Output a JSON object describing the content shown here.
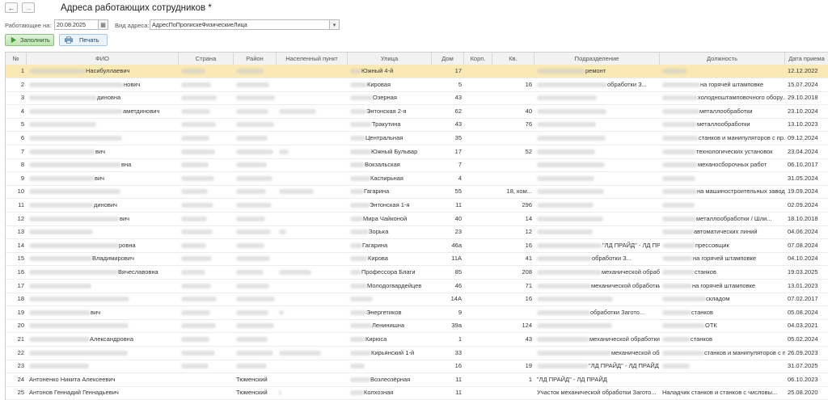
{
  "window": {
    "title": "Адреса работающих сотрудников *"
  },
  "nav": {
    "back_icon": "←",
    "forward_icon": "→"
  },
  "filters": {
    "working_on_label": "Работающие на:",
    "date_value": "20.08.2025",
    "calendar_icon": "▦",
    "address_type_label": "Вид адреса:",
    "address_type_value": "АдресПоПропискеФизическиеЛица",
    "dropdown_icon": "▾"
  },
  "toolbar": {
    "fill_label": "Заполнить",
    "print_label": "Печать"
  },
  "columns": [
    "№",
    "ФИО",
    "Страна",
    "Район",
    "Населенный пункт",
    "Улица",
    "Дом",
    "Корп.",
    "Кв.",
    "Подразделение",
    "Должность",
    "Дата приема"
  ],
  "rows": [
    {
      "n": "1",
      "fio": "Насибуллаевич",
      "street": "Южный 4-й",
      "house": "17",
      "corp": "",
      "flat": "",
      "dept": "ремонт",
      "pos": "",
      "date": "12.12.2022"
    },
    {
      "n": "2",
      "fio": "нович",
      "street": "Кировая",
      "house": "5",
      "corp": "",
      "flat": "16",
      "dept": "обработки З...",
      "pos": "на горячей штамповке",
      "date": "15.07.2024"
    },
    {
      "n": "3",
      "fio": "диновна",
      "street": "Озерная",
      "house": "43",
      "corp": "",
      "flat": "",
      "dept": "",
      "pos": "холодноштамповочного обору...",
      "date": "29.10.2018"
    },
    {
      "n": "4",
      "fio": "аметдинович",
      "street": "Энтонская 2-я",
      "house": "62",
      "corp": "",
      "flat": "40",
      "dept": "",
      "pos": "металлообработки",
      "date": "23.10.2024"
    },
    {
      "n": "5",
      "fio": "",
      "street": "Тракутина",
      "house": "43",
      "corp": "",
      "flat": "76",
      "dept": "",
      "pos": "металлообработки",
      "date": "13.10.2023"
    },
    {
      "n": "6",
      "fio": "",
      "street": "Центральная",
      "house": "35",
      "corp": "",
      "flat": "",
      "dept": "",
      "pos": "станков и манипуляторов с пр...",
      "date": "09.12.2024"
    },
    {
      "n": "7",
      "fio": "вич",
      "street": "Южный Бульвар",
      "house": "17",
      "corp": "",
      "flat": "52",
      "dept": "",
      "pos": "технологических установок",
      "date": "23.04.2024"
    },
    {
      "n": "8",
      "fio": "вна",
      "street": "Вокзальская",
      "house": "7",
      "corp": "",
      "flat": "",
      "dept": "",
      "pos": "механосборочных работ",
      "date": "06.10.2017"
    },
    {
      "n": "9",
      "fio": "вич",
      "street": "Каспирьная",
      "house": "4",
      "corp": "",
      "flat": "",
      "dept": "",
      "pos": "",
      "date": "31.05.2024"
    },
    {
      "n": "10",
      "fio": "",
      "street": "Гагарина",
      "house": "55",
      "corp": "",
      "flat": "18, ком...",
      "dept": "",
      "pos": "на машиностроительных заводах",
      "date": "19.09.2024"
    },
    {
      "n": "11",
      "fio": "динович",
      "street": "Энтонская 1-я",
      "house": "11",
      "corp": "",
      "flat": "296",
      "dept": "",
      "pos": "",
      "date": "02.09.2024"
    },
    {
      "n": "12",
      "fio": "вич",
      "street": "Мира Чайконой",
      "house": "40",
      "corp": "",
      "flat": "14",
      "dept": "",
      "pos": "металлообработки / Шли...",
      "date": "18.10.2018"
    },
    {
      "n": "13",
      "fio": "",
      "street": "Зорька",
      "house": "23",
      "corp": "",
      "flat": "12",
      "dept": "",
      "pos": "автоматических линий",
      "date": "04.06.2024"
    },
    {
      "n": "14",
      "fio": "ровна",
      "street": "Гагарина",
      "house": "46а",
      "corp": "",
      "flat": "16",
      "dept": "\"ЛД ПРАЙД\" - ЛД ПРАЙД",
      "pos": "прессовщик",
      "date": "07.08.2024"
    },
    {
      "n": "15",
      "fio": "Владимирович",
      "street": "Кирова",
      "house": "11А",
      "corp": "",
      "flat": "41",
      "dept": "обработки З...",
      "pos": "на горячей штамповке",
      "date": "04.10.2024"
    },
    {
      "n": "16",
      "fio": "Вячеславовна",
      "street": "Профессора Благи",
      "house": "85",
      "corp": "",
      "flat": "208",
      "dept": "механической обработки Загото...",
      "pos": "станков",
      "date": "19.03.2025"
    },
    {
      "n": "17",
      "fio": "",
      "street": "Молодогвардейцев",
      "house": "46",
      "corp": "",
      "flat": "71",
      "dept": "механической обработки Загото...",
      "pos": "на горячей штамповке",
      "date": "13.01.2023"
    },
    {
      "n": "18",
      "fio": "",
      "street": "",
      "house": "14А",
      "corp": "",
      "flat": "16",
      "dept": "",
      "pos": "складом",
      "date": "07.02.2017"
    },
    {
      "n": "19",
      "fio": "вич",
      "street": "Энергетиков",
      "house": "9",
      "corp": "",
      "flat": "",
      "dept": "обработки Загото...",
      "pos": "станков",
      "date": "05.08.2024"
    },
    {
      "n": "20",
      "fio": "",
      "street": "Ленинишна",
      "house": "39а",
      "corp": "",
      "flat": "124",
      "dept": "",
      "pos": "ОТК",
      "date": "04.03.2021"
    },
    {
      "n": "21",
      "fio": "Александровна",
      "street": "Кирюса",
      "house": "1",
      "corp": "",
      "flat": "43",
      "dept": "механической обработки Загото...",
      "pos": "станков",
      "date": "05.02.2024"
    },
    {
      "n": "22",
      "fio": "",
      "street": "Кирьянский 1-й",
      "house": "33",
      "corp": "",
      "flat": "",
      "dept": "механической обработки Загото...",
      "pos": "станков и манипуляторов с пр...",
      "date": "26.09.2023"
    },
    {
      "n": "23",
      "fio": "",
      "street": "",
      "house": "16",
      "corp": "",
      "flat": "19",
      "dept": "\"ЛД ПРАЙД\" - ЛД ПРАЙД",
      "pos": "",
      "date": "31.07.2025"
    },
    {
      "n": "24",
      "fio": "Антоненко Никита Алексеевич",
      "country": "",
      "district": "Тюменский",
      "street": "Возлеозёрная",
      "house": "11",
      "corp": "",
      "flat": "1",
      "dept": "\"ЛД ПРАЙД\" - ЛД ПРАЙД",
      "pos": "",
      "date": "06.10.2023"
    },
    {
      "n": "25",
      "fio": "Антонов Геннадий Геннадьевич",
      "country": "",
      "district": "Тюменский",
      "street": "Колхозная",
      "house": "11",
      "corp": "",
      "flat": "",
      "dept": "Участок механической обработки Загото...",
      "pos": "Наладчик станков и станков с числовы...",
      "date": "25.08.2020"
    }
  ]
}
